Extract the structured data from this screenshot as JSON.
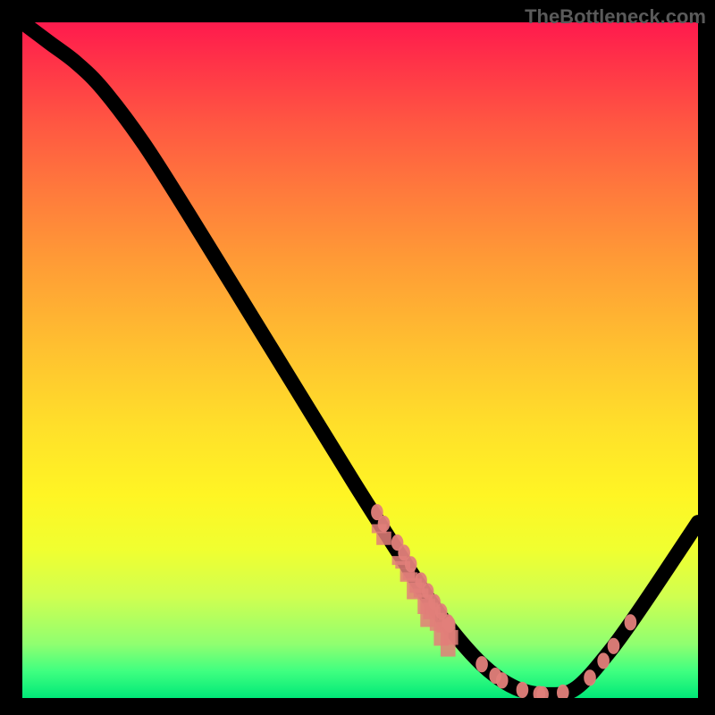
{
  "attribution": "TheBottleneck.com",
  "chart_data": {
    "type": "line",
    "title": "",
    "xlabel": "",
    "ylabel": "",
    "xlim": [
      0,
      100
    ],
    "ylim": [
      0,
      100
    ],
    "curve": [
      {
        "x": 0,
        "y": 100
      },
      {
        "x": 4,
        "y": 97
      },
      {
        "x": 8,
        "y": 94
      },
      {
        "x": 12,
        "y": 90
      },
      {
        "x": 18,
        "y": 82
      },
      {
        "x": 25,
        "y": 71
      },
      {
        "x": 33,
        "y": 58
      },
      {
        "x": 41,
        "y": 45
      },
      {
        "x": 49,
        "y": 32
      },
      {
        "x": 56,
        "y": 21
      },
      {
        "x": 62,
        "y": 12
      },
      {
        "x": 68,
        "y": 5
      },
      {
        "x": 73,
        "y": 1.5
      },
      {
        "x": 78,
        "y": 0.5
      },
      {
        "x": 82,
        "y": 1.5
      },
      {
        "x": 87,
        "y": 7
      },
      {
        "x": 92,
        "y": 14
      },
      {
        "x": 100,
        "y": 26
      }
    ],
    "dots": [
      {
        "x": 52.5,
        "y": 27.5
      },
      {
        "x": 53.5,
        "y": 25.8
      },
      {
        "x": 55.5,
        "y": 23
      },
      {
        "x": 56.5,
        "y": 21.5
      },
      {
        "x": 57.5,
        "y": 19.8
      },
      {
        "x": 59,
        "y": 17.4
      },
      {
        "x": 60,
        "y": 15.8
      },
      {
        "x": 61,
        "y": 14.2
      },
      {
        "x": 62,
        "y": 12.8
      },
      {
        "x": 63,
        "y": 11.2
      },
      {
        "x": 63.2,
        "y": 10.9
      },
      {
        "x": 68,
        "y": 5
      },
      {
        "x": 70,
        "y": 3.3
      },
      {
        "x": 71,
        "y": 2.6
      },
      {
        "x": 74,
        "y": 1.2
      },
      {
        "x": 76.5,
        "y": 0.6
      },
      {
        "x": 77,
        "y": 0.55
      },
      {
        "x": 80,
        "y": 0.8
      },
      {
        "x": 84,
        "y": 3
      },
      {
        "x": 86,
        "y": 5.5
      },
      {
        "x": 87.5,
        "y": 7.7
      },
      {
        "x": 90,
        "y": 11.2
      }
    ],
    "barcode_ticks": [
      {
        "x": 52.8,
        "h": 0.6
      },
      {
        "x": 53.5,
        "h": 0.9
      },
      {
        "x": 55.8,
        "h": 0.6
      },
      {
        "x": 56.3,
        "h": 0.5
      },
      {
        "x": 57.0,
        "h": 0.9
      },
      {
        "x": 57.4,
        "h": 0.5
      },
      {
        "x": 58.0,
        "h": 1.4
      },
      {
        "x": 58.4,
        "h": 0.7
      },
      {
        "x": 59.0,
        "h": 0.6
      },
      {
        "x": 59.6,
        "h": 1.3
      },
      {
        "x": 60.0,
        "h": 1.9
      },
      {
        "x": 60.4,
        "h": 1.1
      },
      {
        "x": 60.8,
        "h": 0.5
      },
      {
        "x": 61.4,
        "h": 1.2
      },
      {
        "x": 62.0,
        "h": 1.8
      },
      {
        "x": 62.4,
        "h": 0.7
      },
      {
        "x": 63.0,
        "h": 2.0
      },
      {
        "x": 63.4,
        "h": 1.0
      }
    ],
    "colors": {
      "curve": "#000000",
      "dots": "#e27f7a",
      "gradient_top": "#ff1a4d",
      "gradient_mid": "#ffe02a",
      "gradient_bottom": "#00e878"
    }
  }
}
